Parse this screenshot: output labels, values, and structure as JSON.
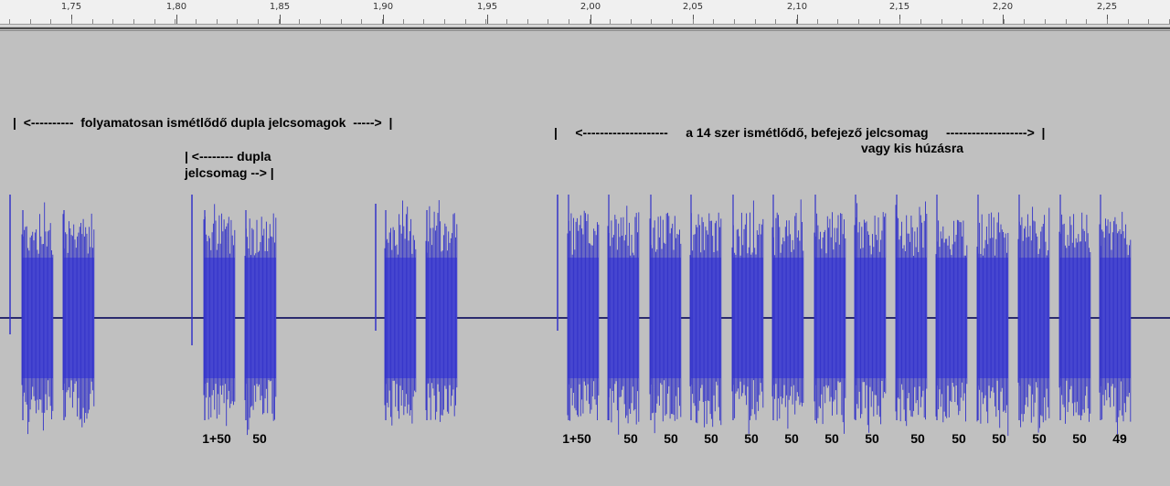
{
  "ruler": {
    "ticks": [
      "1,75",
      "1,80",
      "1,85",
      "1,90",
      "1,95",
      "2,00",
      "2,05",
      "2,10",
      "2,15",
      "2,20",
      "2,25"
    ]
  },
  "annotations": {
    "continuous": "|  <----------  folyamatosan ismétlődő dupla jelcsomagok  ----->  |",
    "double_line1": "| <-------- dupla",
    "double_line2": "jelcsomag --> |",
    "final_line1": "|     <--------------------     a 14 szer ismétlődő, befejező jelcsomag     ------------------->  |",
    "final_line2": "vagy kis húzásra"
  },
  "burst_labels": [
    "1+50",
    "50",
    "1+50",
    "50",
    "50",
    "50",
    "50",
    "50",
    "50",
    "50",
    "50",
    "50",
    "50",
    "50",
    "50",
    "49"
  ],
  "colors": {
    "background": "#c0c0c0",
    "waveform_fill": "#6464dc",
    "waveform_spike": "#3232c8",
    "baseline": "#2a2a6e"
  }
}
